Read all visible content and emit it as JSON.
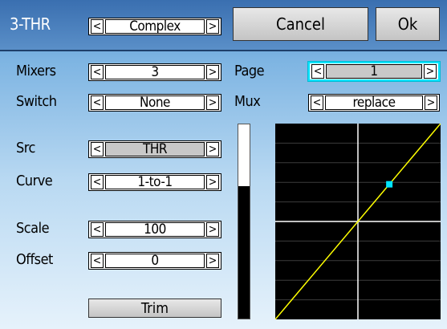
{
  "header": {
    "title": "3-THR",
    "mode": "Complex",
    "cancel_label": "Cancel",
    "ok_label": "Ok"
  },
  "fields": {
    "mixers": {
      "label": "Mixers",
      "value": "3"
    },
    "page": {
      "label": "Page",
      "value": "1"
    },
    "switch": {
      "label": "Switch",
      "value": "None"
    },
    "mux": {
      "label": "Mux",
      "value": "replace"
    },
    "src": {
      "label": "Src",
      "value": "THR"
    },
    "curve": {
      "label": "Curve",
      "value": "1-to-1"
    },
    "scale": {
      "label": "Scale",
      "value": "100"
    },
    "offset": {
      "label": "Offset",
      "value": "0"
    }
  },
  "trim_label": "Trim",
  "arrows": {
    "left": "<",
    "right": ">"
  },
  "output_level": 0.68,
  "chart_data": {
    "type": "line",
    "title": "",
    "xlabel": "",
    "ylabel": "",
    "xlim": [
      -100,
      100
    ],
    "ylim": [
      -100,
      100
    ],
    "grid": true,
    "series": [
      {
        "values": [
          [
            -100,
            -100
          ],
          [
            100,
            100
          ]
        ],
        "color": "#ffff00"
      }
    ],
    "marker": {
      "x": 38,
      "y": 38,
      "color": "#00e5ff"
    },
    "crosshair": {
      "x": 0,
      "y": 0,
      "color": "#ffffff"
    }
  },
  "colors": {
    "selected_border": "#00e5ff",
    "curve_line": "#ffff00",
    "graph_bg": "#000000"
  }
}
